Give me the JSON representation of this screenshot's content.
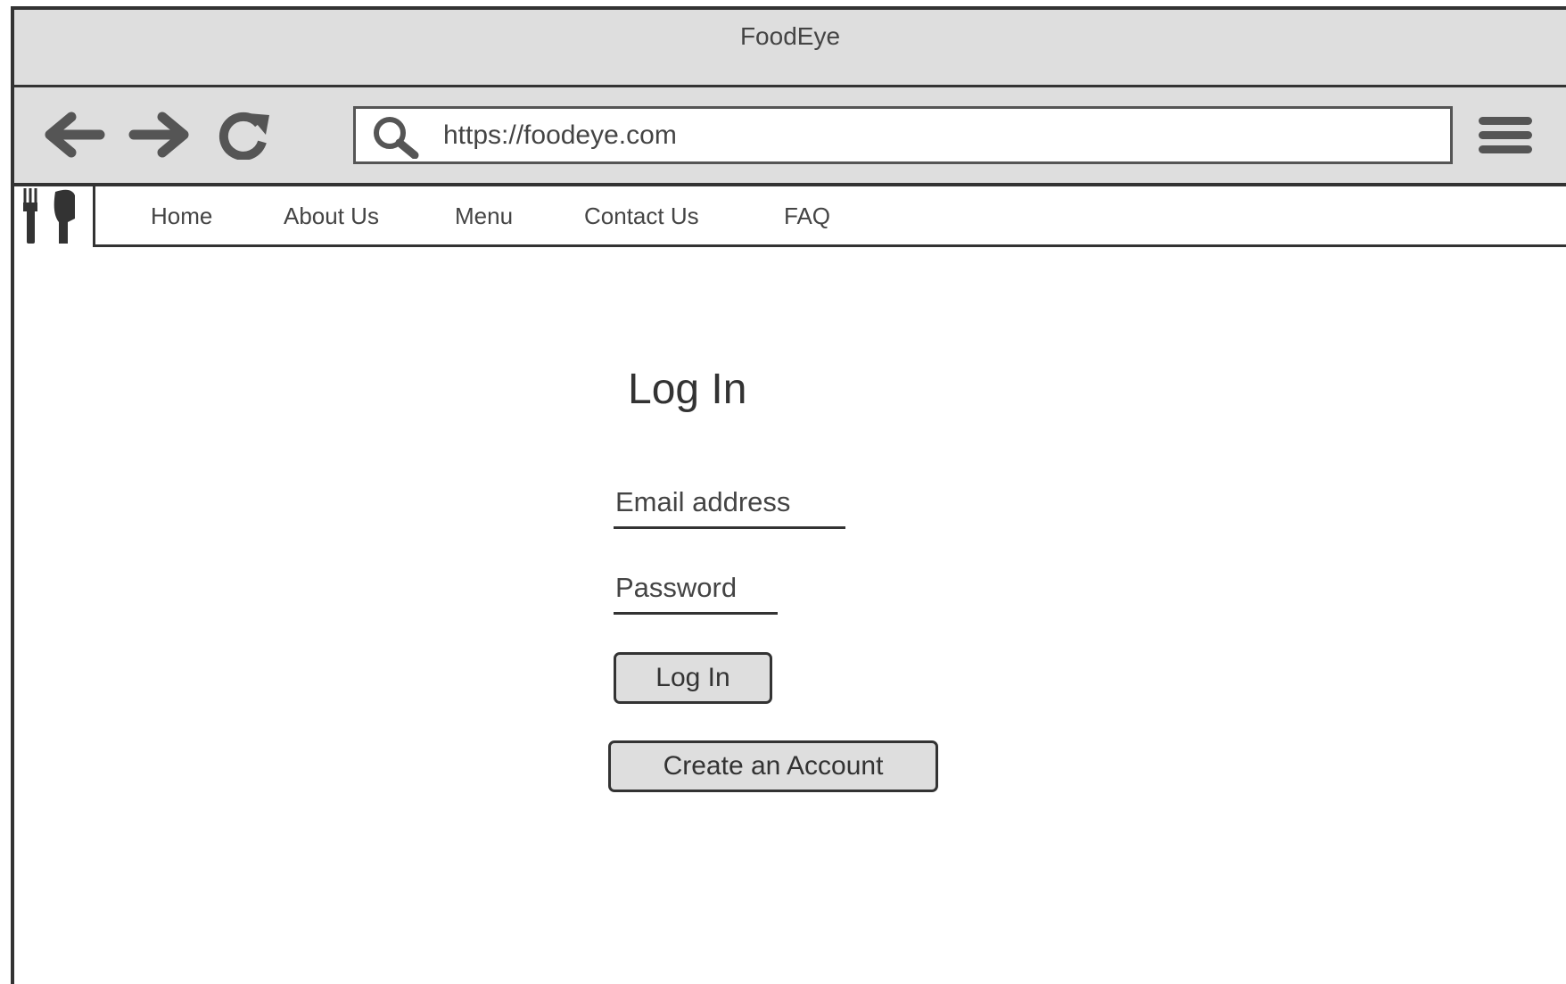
{
  "window": {
    "title": "FoodEye"
  },
  "browser": {
    "url": "https://foodeye.com",
    "icons": [
      "back-arrow-icon",
      "forward-arrow-icon",
      "reload-icon",
      "search-icon",
      "hamburger-menu-icon"
    ]
  },
  "nav": {
    "logo_icon": "fork-knife-icon",
    "items": [
      {
        "label": "Home"
      },
      {
        "label": "About Us"
      },
      {
        "label": "Menu"
      },
      {
        "label": "Contact Us"
      },
      {
        "label": "FAQ"
      }
    ]
  },
  "login": {
    "title": "Log In",
    "email_label": "Email address",
    "password_label": "Password",
    "login_button": "Log In",
    "create_account_button": "Create an Account"
  },
  "colors": {
    "chrome_bg": "#dedede",
    "border": "#333333",
    "text": "#444444",
    "page_bg": "#ffffff"
  }
}
